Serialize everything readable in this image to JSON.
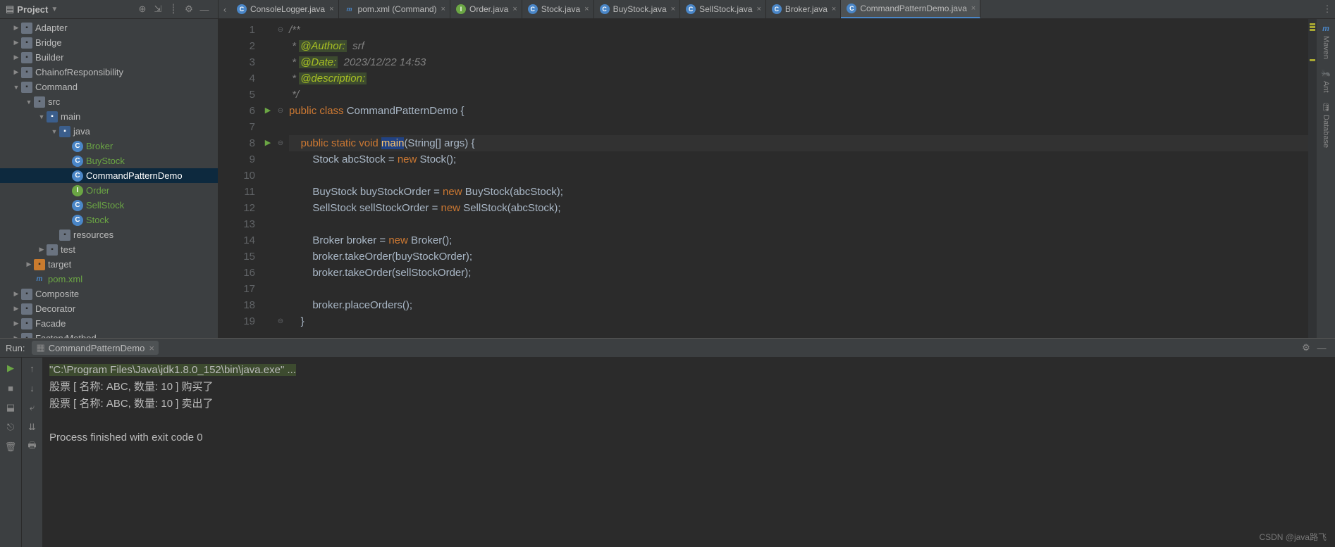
{
  "sidebar": {
    "title": "Project",
    "toolbar_icons": [
      "target-icon",
      "expand-icon",
      "divider",
      "gear-icon",
      "minimize-icon"
    ],
    "tree": [
      {
        "depth": 0,
        "arrow": "closed",
        "icon": "folder",
        "label": "Adapter"
      },
      {
        "depth": 0,
        "arrow": "closed",
        "icon": "folder",
        "label": "Bridge"
      },
      {
        "depth": 0,
        "arrow": "closed",
        "icon": "folder",
        "label": "Builder"
      },
      {
        "depth": 0,
        "arrow": "closed",
        "icon": "folder",
        "label": "ChainofResponsibility"
      },
      {
        "depth": 0,
        "arrow": "open",
        "icon": "folder",
        "label": "Command"
      },
      {
        "depth": 1,
        "arrow": "open",
        "icon": "folder",
        "label": "src"
      },
      {
        "depth": 2,
        "arrow": "open",
        "icon": "folder-src",
        "label": "main"
      },
      {
        "depth": 3,
        "arrow": "open",
        "icon": "folder-src",
        "label": "java"
      },
      {
        "depth": 4,
        "arrow": "",
        "icon": "java-c",
        "iconText": "C",
        "label": "Broker",
        "green": true
      },
      {
        "depth": 4,
        "arrow": "",
        "icon": "java-c",
        "iconText": "C",
        "label": "BuyStock",
        "green": true
      },
      {
        "depth": 4,
        "arrow": "",
        "icon": "java-c",
        "iconText": "C",
        "label": "CommandPatternDemo",
        "sel": true
      },
      {
        "depth": 4,
        "arrow": "",
        "icon": "java-i",
        "iconText": "I",
        "label": "Order",
        "green": true
      },
      {
        "depth": 4,
        "arrow": "",
        "icon": "java-c",
        "iconText": "C",
        "label": "SellStock",
        "green": true
      },
      {
        "depth": 4,
        "arrow": "",
        "icon": "java-c",
        "iconText": "C",
        "label": "Stock",
        "green": true
      },
      {
        "depth": 3,
        "arrow": "",
        "icon": "folder",
        "label": "resources"
      },
      {
        "depth": 2,
        "arrow": "closed",
        "icon": "folder",
        "label": "test"
      },
      {
        "depth": 1,
        "arrow": "closed",
        "icon": "folder-orange",
        "label": "target"
      },
      {
        "depth": 1,
        "arrow": "",
        "icon": "maven",
        "iconText": "m",
        "label": "pom.xml",
        "green": true
      },
      {
        "depth": 0,
        "arrow": "closed",
        "icon": "folder",
        "label": "Composite"
      },
      {
        "depth": 0,
        "arrow": "closed",
        "icon": "folder",
        "label": "Decorator"
      },
      {
        "depth": 0,
        "arrow": "closed",
        "icon": "folder",
        "label": "Facade"
      },
      {
        "depth": 0,
        "arrow": "closed",
        "icon": "folder",
        "label": "FactoryMethod"
      }
    ]
  },
  "tabs": {
    "items": [
      {
        "icon": "c",
        "name": "ConsoleLogger.java"
      },
      {
        "icon": "m",
        "name": "pom.xml (Command)"
      },
      {
        "icon": "i",
        "name": "Order.java"
      },
      {
        "icon": "c",
        "name": "Stock.java"
      },
      {
        "icon": "c",
        "name": "BuyStock.java"
      },
      {
        "icon": "c",
        "name": "SellStock.java"
      },
      {
        "icon": "c",
        "name": "Broker.java"
      },
      {
        "icon": "c",
        "name": "CommandPatternDemo.java",
        "active": true
      }
    ]
  },
  "code": {
    "lines": [
      {
        "n": 1,
        "fold": "⊖",
        "html": "<span class='cm'>/**</span>"
      },
      {
        "n": 2,
        "html": "<span class='cm'> * </span><span class='cm-tag'>@Author:</span><span class='cm'>  srf</span>"
      },
      {
        "n": 3,
        "html": "<span class='cm'> * </span><span class='cm-tag'>@Date:</span><span class='cm'>  2023/12/22 14:53</span>"
      },
      {
        "n": 4,
        "html": "<span class='cm'> * </span><span class='cm-tag'>@description:</span>"
      },
      {
        "n": 5,
        "html": "<span class='cm'> */</span>"
      },
      {
        "n": 6,
        "run": true,
        "fold": "⊖",
        "html": "<span class='kw'>public class</span> <span class='id'>CommandPatternDemo {</span>"
      },
      {
        "n": 7,
        "html": ""
      },
      {
        "n": 8,
        "run": true,
        "fold": "⊖",
        "cur": true,
        "html": "    <span class='kw'>public static</span> <span class='kw'>void</span> <span class='fn'><span class='main-hl'>main</span></span><span class='id'>(String[] args) {</span>"
      },
      {
        "n": 9,
        "html": "        <span class='id'>Stock abcStock = </span><span class='kw'>new</span> <span class='id'>Stock();</span>"
      },
      {
        "n": 10,
        "html": ""
      },
      {
        "n": 11,
        "html": "        <span class='id'>BuyStock buyStockOrder = </span><span class='kw'>new</span> <span class='id'>BuyStock(abcStock);</span>"
      },
      {
        "n": 12,
        "html": "        <span class='id'>SellStock sellStockOrder = </span><span class='kw'>new</span> <span class='id'>SellStock(abcStock);</span>"
      },
      {
        "n": 13,
        "html": ""
      },
      {
        "n": 14,
        "html": "        <span class='id'>Broker broker = </span><span class='kw'>new</span> <span class='id'>Broker();</span>"
      },
      {
        "n": 15,
        "html": "        <span class='id'>broker.takeOrder(buyStockOrder);</span>"
      },
      {
        "n": 16,
        "html": "        <span class='id'>broker.takeOrder(sellStockOrder);</span>"
      },
      {
        "n": 17,
        "html": ""
      },
      {
        "n": 18,
        "html": "        <span class='id'>broker.placeOrders();</span>"
      },
      {
        "n": 19,
        "fold": "⊖",
        "html": "    <span class='id'>}</span>"
      }
    ]
  },
  "run": {
    "label": "Run:",
    "tab": "CommandPatternDemo",
    "output": {
      "cmd": "\"C:\\Program Files\\Java\\jdk1.8.0_152\\bin\\java.exe\" ...",
      "lines": [
        "股票 [ 名称: ABC, 数量: 10 ] 购买了",
        "股票 [ 名称: ABC, 数量: 10 ] 卖出了",
        "",
        "Process finished with exit code 0"
      ]
    }
  },
  "right_tools": [
    "Maven",
    "Ant",
    "Database"
  ],
  "watermark": "CSDN @java路飞"
}
